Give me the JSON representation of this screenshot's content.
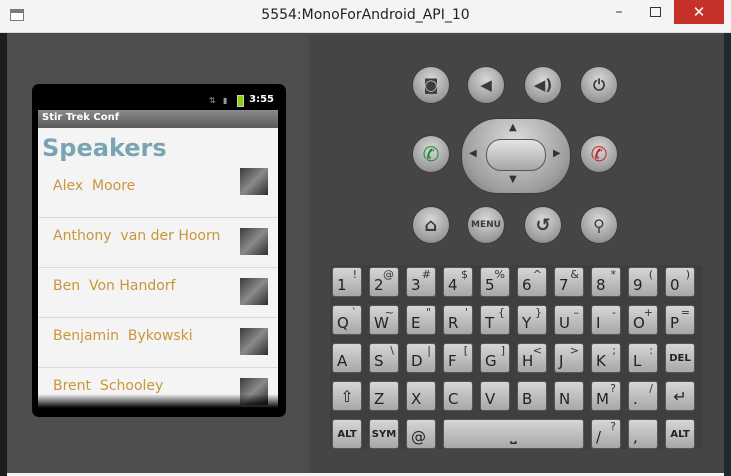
{
  "window": {
    "title": "5554:MonoForAndroid_API_10",
    "minimize_glyph": "–",
    "close_glyph": "✕"
  },
  "phone": {
    "status_time": "3:55",
    "status_icons": [
      "network-icon",
      "signal-icon",
      "battery-icon"
    ],
    "app_title": "Stir Trek Conf",
    "heading": "Speakers",
    "speakers": [
      "Alex  Moore",
      "Anthony  van der Hoorn",
      "Ben  Von Handorf",
      "Benjamin  Bykowski",
      "Brent  Schooley"
    ]
  },
  "hardware_buttons": {
    "menu_label": "MENU"
  },
  "keyboard": {
    "row1": [
      [
        "1",
        "!"
      ],
      [
        "2",
        "@"
      ],
      [
        "3",
        "#"
      ],
      [
        "4",
        "$"
      ],
      [
        "5",
        "%"
      ],
      [
        "6",
        "^"
      ],
      [
        "7",
        "&"
      ],
      [
        "8",
        "*"
      ],
      [
        "9",
        "("
      ],
      [
        "0",
        ")"
      ]
    ],
    "row2": [
      [
        "Q",
        "`"
      ],
      [
        "W",
        "~"
      ],
      [
        "E",
        "\""
      ],
      [
        "R",
        "'"
      ],
      [
        "T",
        "{"
      ],
      [
        "Y",
        "}"
      ],
      [
        "U",
        "–"
      ],
      [
        "I",
        "-"
      ],
      [
        "O",
        "+"
      ],
      [
        "P",
        "="
      ]
    ],
    "row3": [
      [
        "A",
        ""
      ],
      [
        "S",
        "\\"
      ],
      [
        "D",
        "|"
      ],
      [
        "F",
        "["
      ],
      [
        "G",
        "]"
      ],
      [
        "H",
        "<"
      ],
      [
        "J",
        ">"
      ],
      [
        "K",
        ";"
      ],
      [
        "L",
        ":"
      ]
    ],
    "del_label": "DEL",
    "row4": [
      [
        "Z",
        ""
      ],
      [
        "X",
        ""
      ],
      [
        "C",
        ""
      ],
      [
        "V",
        ""
      ],
      [
        "B",
        ""
      ],
      [
        "N",
        ""
      ],
      [
        "M",
        "?"
      ],
      [
        ".",
        "/"
      ]
    ],
    "alt_label": "ALT",
    "sym_label": "SYM",
    "at_key": "@",
    "slash_key": "/",
    "slash_secondary": "?",
    "comma_key": ","
  },
  "colors": {
    "heading": "#7aa4b3",
    "speaker_name": "#c9963c",
    "close_button": "#c7312b",
    "call_green": "#1a8a2a",
    "end_red": "#c22020"
  }
}
